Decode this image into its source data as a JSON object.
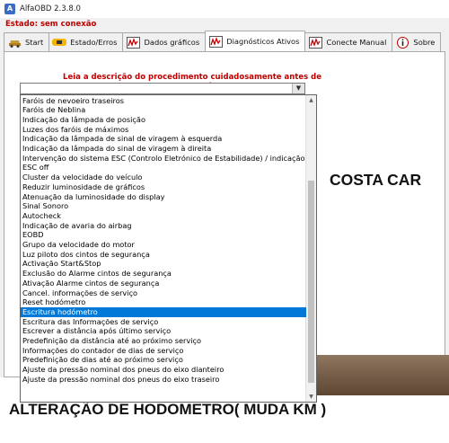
{
  "window": {
    "title": "AlfaOBD 2.3.8.0"
  },
  "status": {
    "text": "Estado: sem conexão"
  },
  "tabs": [
    {
      "label": "Start",
      "icon": "car-icon"
    },
    {
      "label": "Estado/Erros",
      "icon": "warning-icon"
    },
    {
      "label": "Dados gráficos",
      "icon": "chart-icon"
    },
    {
      "label": "Diagnósticos Ativos",
      "icon": "chart-icon"
    },
    {
      "label": "Conecte Manual",
      "icon": "chart-icon"
    },
    {
      "label": "Sobre",
      "icon": "info-icon"
    }
  ],
  "active_tab": "Diagnósticos Ativos",
  "instruction": "Leia a descrição do procedimento cuidadosamente antes de começar!",
  "combo": {
    "value": ""
  },
  "dropdown": {
    "selected_index": 23,
    "items": [
      "Faróis de nevoeiro traseiros",
      "Faróis de Neblina",
      "Indicação da lâmpada de posição",
      "Luzes dos faróis de máximos",
      "Indicação da lâmpada de sinal de viragem à esquerda",
      "Indicação da lâmpada do sinal de viragem à direita",
      "Intervenção do sistema ESC (Controlo Eletrónico de Estabilidade) / indicação de ",
      "ESC off",
      "Cluster da velocidade do veículo",
      "Reduzir luminosidade de gráficos",
      "Atenuação da luminosidade do display",
      "Sinal Sonoro",
      "Autocheck",
      "Indicação de avaria do airbag",
      "EOBD",
      "Grupo da velocidade do motor",
      "Luz piloto dos cintos de segurança",
      "Activação Start&Stop",
      "Exclusão do Alarme cintos de segurança",
      "Ativação Alarme cintos de segurança",
      "Cancel. informações de serviço",
      "Reset hodómetro",
      "Escritura hodómetro",
      "Escritura das Informações de serviço",
      "Escrever a distância após último serviço",
      "Predefinição da distância até ao próximo serviço",
      "Informações do contador de dias de serviço",
      "Predefinição de dias até ao próximo serviço",
      "Ajuste da pressão nominal dos pneus do eixo dianteiro",
      "Ajuste da pressão nominal dos pneus do eixo traseiro"
    ]
  },
  "overlay": {
    "company": "COSTA CAR",
    "caption": "ALTERAÇÃO DE HODOMETRO( MUDA KM )"
  },
  "colors": {
    "status_red": "#c00000",
    "selection_blue": "#0078d7"
  }
}
